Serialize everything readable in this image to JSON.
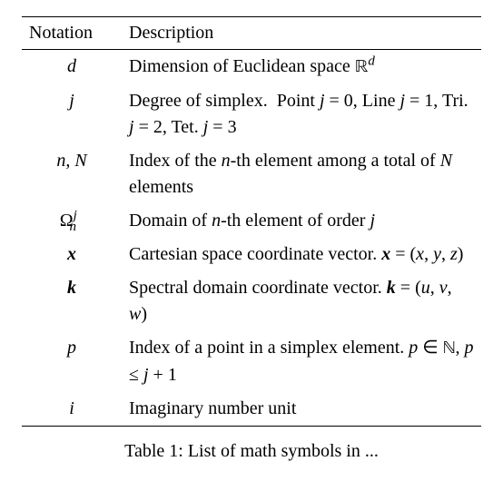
{
  "chart_data": {
    "type": "table",
    "title": "List of math symbols in ...",
    "columns": [
      "Notation",
      "Description"
    ],
    "rows": [
      {
        "notation": "d",
        "description": "Dimension of Euclidean space ℝ^d"
      },
      {
        "notation": "j",
        "description": "Degree of simplex. Point j = 0, Line j = 1, Tri. j = 2, Tet. j = 3"
      },
      {
        "notation": "n, N",
        "description": "Index of the n-th element among a total of N elements"
      },
      {
        "notation": "Ω_n^j",
        "description": "Domain of n-th element of order j"
      },
      {
        "notation": "x (bold)",
        "description": "Cartesian space coordinate vector. x = (x, y, z)"
      },
      {
        "notation": "k (bold)",
        "description": "Spectral domain coordinate vector. k = (u, v, w)"
      },
      {
        "notation": "p",
        "description": "Index of a point in a simplex element. p ∈ ℕ, p ≤ j + 1"
      },
      {
        "notation": "i",
        "description": "Imaginary number unit"
      }
    ]
  },
  "headers": {
    "notation": "Notation",
    "description": "Description"
  },
  "rows": {
    "r0": {
      "notation_html": "<span>d</span>",
      "desc_html": "Dimension of Euclidean space <span class=\"bb\">ℝ</span><sup><span style=\"font-style:italic\">d</span></sup>"
    },
    "r1": {
      "notation_html": "<span>j</span>",
      "desc_html": "Degree of simplex. &nbsp;Point <span style=\"font-style:italic\">j</span> = 0, Line <span style=\"font-style:italic\">j</span> = 1, Tri. <span style=\"font-style:italic\">j</span> = 2, Tet. <span style=\"font-style:italic\">j</span> = 3"
    },
    "r2": {
      "notation_html": "<span>n</span><span class=\"rm\">,</span> <span>N</span>",
      "desc_html": "Index of the <span style=\"font-style:italic\">n</span>-th element among a total of <span style=\"font-style:italic\">N</span> elements"
    },
    "r3": {
      "notation_html": "<span class=\"omega-cell\"><span class=\"rm\">Ω</span><sup>j</sup><sub>n</sub></span>",
      "desc_html": "Domain of <span style=\"font-style:italic\">n</span>-th element of order <span style=\"font-style:italic\">j</span>"
    },
    "r4": {
      "notation_html": "<span class=\"bold-italic\">x</span>",
      "desc_html": "Cartesian space coordinate vector. <span class=\"bold-italic\">x</span> = (<span style=\"font-style:italic\">x</span>, <span style=\"font-style:italic\">y</span>, <span style=\"font-style:italic\">z</span>)"
    },
    "r5": {
      "notation_html": "<span class=\"bold-italic\">k</span>",
      "desc_html": "Spectral domain coordinate vector. <span class=\"bold-italic\">k</span> = (<span style=\"font-style:italic\">u</span>, <span style=\"font-style:italic\">v</span>, <span style=\"font-style:italic\">w</span>)"
    },
    "r6": {
      "notation_html": "<span>p</span>",
      "desc_html": "Index of a point in a simplex element. <span style=\"font-style:italic\">p</span> ∈ <span class=\"bb\">ℕ</span>, <span style=\"font-style:italic\">p</span> ≤ <span style=\"font-style:italic\">j</span> + 1"
    },
    "r7": {
      "notation_html": "<span>i</span>",
      "desc_html": "Imaginary number unit"
    }
  },
  "caption_prefix": "Table 1:",
  "caption_text": "List of math symbols in ..."
}
